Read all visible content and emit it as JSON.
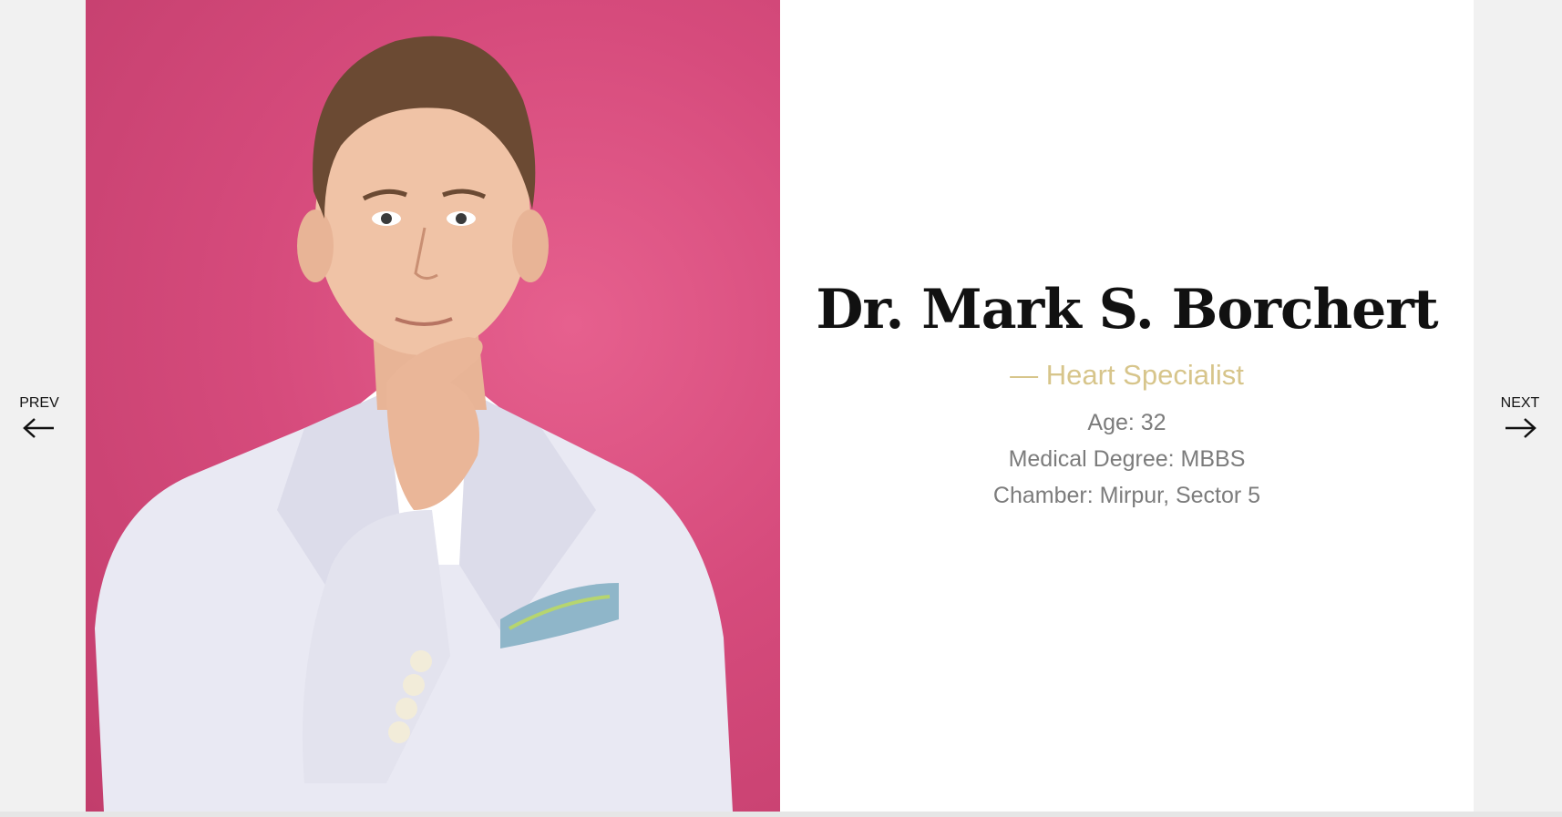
{
  "profile": {
    "name": "Dr. Mark S. Borchert",
    "specialty": "— Heart Specialist",
    "details": [
      "Age: 32",
      "Medical Degree: MBBS",
      "Chamber: Mirpur, Sector 5"
    ],
    "photo_subject": "portrait-photo"
  },
  "navigation": {
    "prev_label": "PREV",
    "next_label": "NEXT",
    "prev_icon": "arrow-left-icon",
    "next_icon": "arrow-right-icon"
  },
  "colors": {
    "page_background": "#f1f1f1",
    "card_background": "#ffffff",
    "photo_background": "#d64b7c",
    "name_color": "#111111",
    "specialty_color": "#d7c58b",
    "detail_color": "#7c7c7c"
  }
}
